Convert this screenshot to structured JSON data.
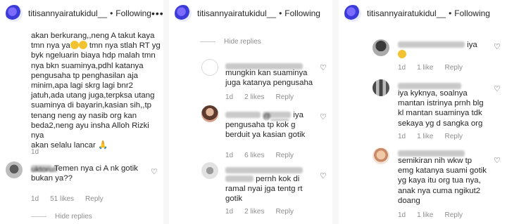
{
  "header": {
    "username": "titisannyairatukidul__",
    "separator": "•",
    "following": "Following",
    "more": "•••"
  },
  "panel1": {
    "comment1_lines": [
      "akan berkurang,,neng A takut kaya",
      "tmn nya ya",
      "byk ngeluarin biaya hdp malah tmn",
      "nya bkn suaminya,pdhl katanya",
      "pengusaha tp penghasilan aja",
      "minim,apa lagi skrg lagi bnr2",
      "jatuh,ada utang juga,terpksa utang",
      "suaminya di bayarin,kasian sih,,tp",
      "tenang neng ay nasib org kan",
      "beda2,neng ayu insha Alloh Rizki nya",
      "akan selalu lancar"
    ],
    "line2_rest": " tmn nya stlah RT yg",
    "comment1_time": "1d",
    "comment2_user": "uktorull",
    "comment2_lines": [
      "Temen nya ci A nk gotik",
      "bukan ya??"
    ],
    "comment2_time": "1d",
    "comment2_likes": "51 likes",
    "comment2_reply": "Reply",
    "hide_replies": "Hide replies"
  },
  "panel2": {
    "hide_replies": "Hide replies",
    "c1_lines": [
      "mungkin kan suaminya",
      "juga katanya pengusaha"
    ],
    "c1_time": "1d",
    "c1_likes": "2 likes",
    "c1_reply": "Reply",
    "c2_mention": "@____ ",
    "c2_lines": [
      "iya",
      "pengusaha tp kok g",
      "berduit ya kasian gotik"
    ],
    "c2_time": "1d",
    "c2_likes": "6 likes",
    "c2_reply": "Reply",
    "c3_lines": [
      "pernh kok di",
      "ramal nyai jga tentg rt",
      "gotik"
    ],
    "c3_time": "1d",
    "c3_likes": "2 likes",
    "c3_reply": "Reply"
  },
  "panel3": {
    "c1_text": "iya",
    "c1_time": "1d",
    "c1_likes": "1 like",
    "c1_reply": "Reply",
    "c2_lines": [
      "iya kyknya, soalnya",
      "mantan istrinya prnh blg",
      "kl mantan suaminya tdk",
      "sekaya yg d sangka org"
    ],
    "c2_time": "1d",
    "c2_likes": "1 like",
    "c2_reply": "Reply",
    "c3_lines": [
      "semikiran nih wkw tp",
      "emg katanya suami gotik",
      "yg kaya itu org tua nya,",
      "anak nya cuma ngikut2",
      "doang"
    ],
    "c3_time": "1d",
    "c3_likes": "1 like",
    "c3_reply": "Reply"
  },
  "colors": {
    "text": "#262626",
    "meta": "#8e8e8e",
    "accent_avatar": "#3b3bd9"
  }
}
